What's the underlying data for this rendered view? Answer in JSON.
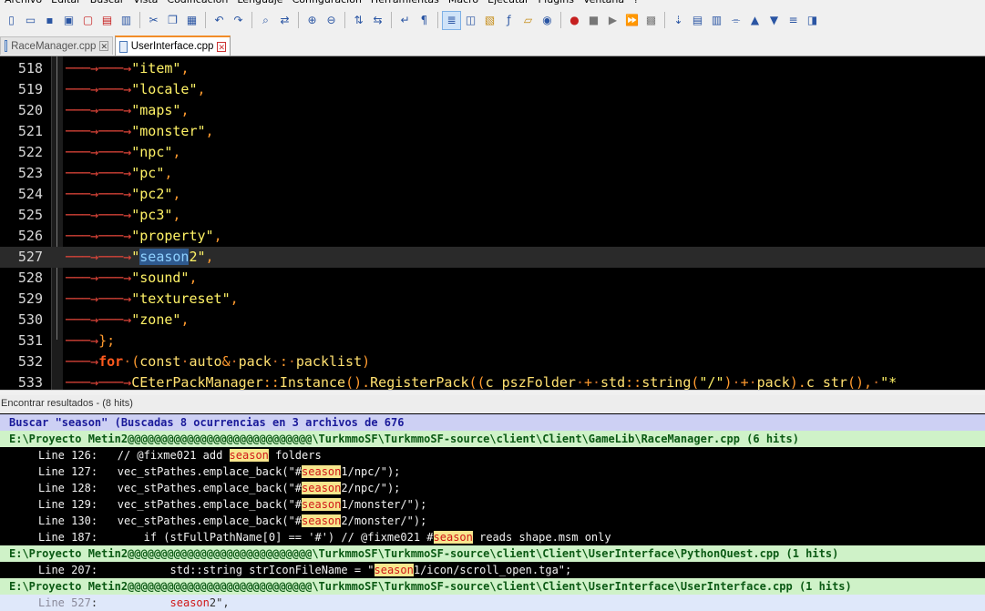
{
  "menu": [
    "Archivo",
    "Editar",
    "Buscar",
    "Vista",
    "Codificación",
    "Lenguaje",
    "Configuración",
    "Herramientas",
    "Macro",
    "Ejecutar",
    "Plugins",
    "Ventana",
    "?"
  ],
  "toolbar": {
    "icons": [
      "new-file-icon",
      "open-file-icon",
      "save-icon",
      "save-all-icon",
      "close-icon",
      "close-all-icon",
      "print-icon",
      "|",
      "cut-icon",
      "copy-icon",
      "paste-icon",
      "|",
      "undo-icon",
      "redo-icon",
      "|",
      "find-icon",
      "replace-icon",
      "|",
      "zoom-in-icon",
      "zoom-out-icon",
      "|",
      "sync-vertical-icon",
      "sync-horizontal-icon",
      "|",
      "word-wrap-icon",
      "show-all-chars-icon",
      "|",
      "indent-guide-icon",
      "udl-icon",
      "doc-map-icon",
      "function-list-icon",
      "folder-as-workspace-icon",
      "monitoring-icon",
      "|",
      "record-macro-icon",
      "stop-macro-icon",
      "play-macro-icon",
      "run-macro-multiple-icon",
      "save-macro-icon",
      "|",
      "compare-icon",
      "panel-1-icon",
      "panel-2-icon",
      "collapse-icon",
      "prev-icon",
      "next-icon",
      "align-icon",
      "panel-3-icon"
    ],
    "active_icon": "indent-guide-icon"
  },
  "tabs": [
    {
      "label": "RaceManager.cpp",
      "active": false
    },
    {
      "label": "UserInterface.cpp",
      "active": true
    }
  ],
  "editor": {
    "current_line": 527,
    "lines": [
      {
        "num": "518",
        "indent": 2,
        "text": "\"item\","
      },
      {
        "num": "519",
        "indent": 2,
        "text": "\"locale\","
      },
      {
        "num": "520",
        "indent": 2,
        "text": "\"maps\","
      },
      {
        "num": "521",
        "indent": 2,
        "text": "\"monster\","
      },
      {
        "num": "522",
        "indent": 2,
        "text": "\"npc\","
      },
      {
        "num": "523",
        "indent": 2,
        "text": "\"pc\","
      },
      {
        "num": "524",
        "indent": 2,
        "text": "\"pc2\","
      },
      {
        "num": "525",
        "indent": 2,
        "text": "\"pc3\","
      },
      {
        "num": "526",
        "indent": 2,
        "text": "\"property\","
      },
      {
        "num": "527",
        "indent": 2,
        "text": "\"season2\",",
        "selected": "season"
      },
      {
        "num": "528",
        "indent": 2,
        "text": "\"sound\","
      },
      {
        "num": "529",
        "indent": 2,
        "text": "\"textureset\","
      },
      {
        "num": "530",
        "indent": 2,
        "text": "\"zone\","
      },
      {
        "num": "531",
        "indent": 1,
        "text": "};"
      },
      {
        "num": "532",
        "indent": 1,
        "text": "for (const auto& pack : packlist)"
      },
      {
        "num": "533",
        "indent": 2,
        "text": "CEterPackManager::Instance().RegisterPack((c_pszFolder + std::string(\"/\") + pack).c_str(), \"*"
      }
    ]
  },
  "find_results": {
    "header": "Encontrar resultados - (8 hits)",
    "search_line": "Buscar \"season\" (Buscadas 8 ocurrencias en 3 archivos de 676",
    "term": "season",
    "groups": [
      {
        "file": "E:\\Proyecto Metin2@@@@@@@@@@@@@@@@@@@@@@@@@@@@\\TurkmmoSF\\TurkmmoSF-source\\client\\Client\\GameLib\\RaceManager.cpp (6 hits)",
        "hits": [
          {
            "label": "Line",
            "num": "126",
            "pre": ":   // @fixme021 add ",
            "post": " folders"
          },
          {
            "label": "Line",
            "num": "127",
            "pre": ":   vec_stPathes.emplace_back(\"#",
            "post": "1/npc/\");"
          },
          {
            "label": "Line",
            "num": "128",
            "pre": ":   vec_stPathes.emplace_back(\"#",
            "post": "2/npc/\");"
          },
          {
            "label": "Line",
            "num": "129",
            "pre": ":   vec_stPathes.emplace_back(\"#",
            "post": "1/monster/\");"
          },
          {
            "label": "Line",
            "num": "130",
            "pre": ":   vec_stPathes.emplace_back(\"#",
            "post": "2/monster/\");"
          },
          {
            "label": "Line",
            "num": "187",
            "pre": ":       if (stFullPathName[0] == '#') // @fixme021 #",
            "post": " reads shape.msm only"
          }
        ]
      },
      {
        "file": "E:\\Proyecto Metin2@@@@@@@@@@@@@@@@@@@@@@@@@@@@\\TurkmmoSF\\TurkmmoSF-source\\client\\Client\\UserInterface\\PythonQuest.cpp (1 hits)",
        "hits": [
          {
            "label": "Line",
            "num": "207",
            "pre": ":           std::string strIconFileName = \"",
            "post": "1/icon/scroll_open.tga\";"
          }
        ]
      },
      {
        "file": "E:\\Proyecto Metin2@@@@@@@@@@@@@@@@@@@@@@@@@@@@\\TurkmmoSF\\TurkmmoSF-source\\client\\Client\\UserInterface\\UserInterface.cpp (1 hits)",
        "hits": [
          {
            "label": "Line",
            "num": "527",
            "pre": ":           ",
            "post": "2\",",
            "current": true
          }
        ]
      }
    ]
  }
}
